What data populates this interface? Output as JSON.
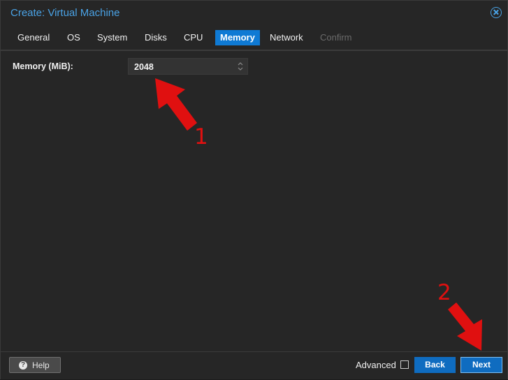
{
  "window": {
    "title": "Create: Virtual Machine",
    "close_icon": "close-circle-icon"
  },
  "tabs": [
    {
      "label": "General",
      "state": "normal"
    },
    {
      "label": "OS",
      "state": "normal"
    },
    {
      "label": "System",
      "state": "normal"
    },
    {
      "label": "Disks",
      "state": "normal"
    },
    {
      "label": "CPU",
      "state": "normal"
    },
    {
      "label": "Memory",
      "state": "active"
    },
    {
      "label": "Network",
      "state": "normal"
    },
    {
      "label": "Confirm",
      "state": "disabled"
    }
  ],
  "form": {
    "memory_label": "Memory (MiB):",
    "memory_value": "2048"
  },
  "annotations": {
    "step1": "1",
    "step2": "2",
    "color": "#e01010"
  },
  "footer": {
    "help_label": "Help",
    "help_icon": "question-circle-icon",
    "advanced_label": "Advanced",
    "advanced_checked": false,
    "back_label": "Back",
    "next_label": "Next"
  },
  "colors": {
    "accent": "#0f7ad4",
    "title": "#4aa3e6",
    "background": "#262626"
  }
}
